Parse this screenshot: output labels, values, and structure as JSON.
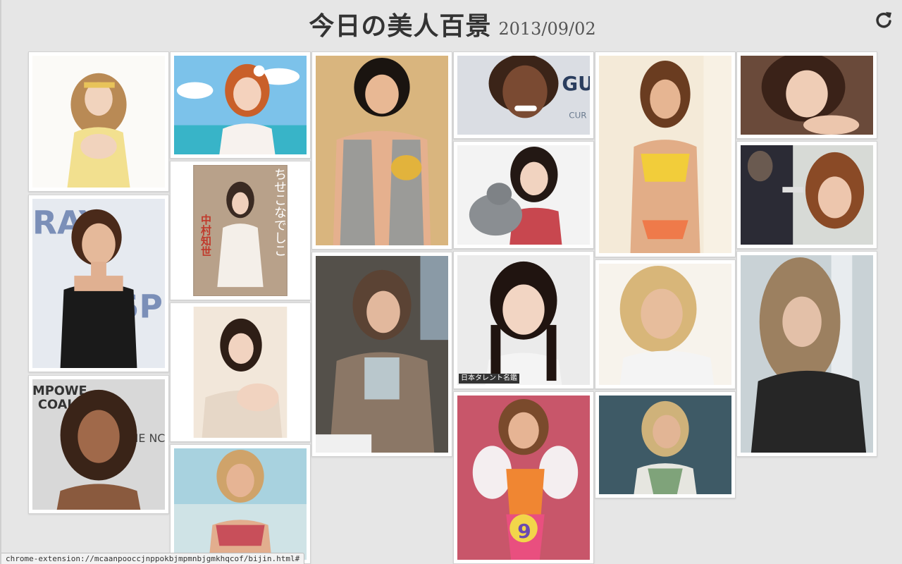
{
  "header": {
    "title": "今日の美人百景",
    "date": "2013/09/02"
  },
  "toolbar": {
    "reload_icon": "reload-icon"
  },
  "status_bar": {
    "url": "chrome-extension://mcaanpooccjnppokbjmpmnbjgmkhqcof/bijin.html#"
  },
  "photo_overlays": {
    "magazine_cover_title": "ちせこなでしこ",
    "magazine_cover_name": "中村知世",
    "talent_caption": "日本タレント名鑑",
    "jersey_number": "9"
  },
  "colors": {
    "background": "#e6e6e6",
    "tile_background": "#ffffff",
    "tile_border": "#d2d2d2",
    "title_text": "#333333"
  }
}
